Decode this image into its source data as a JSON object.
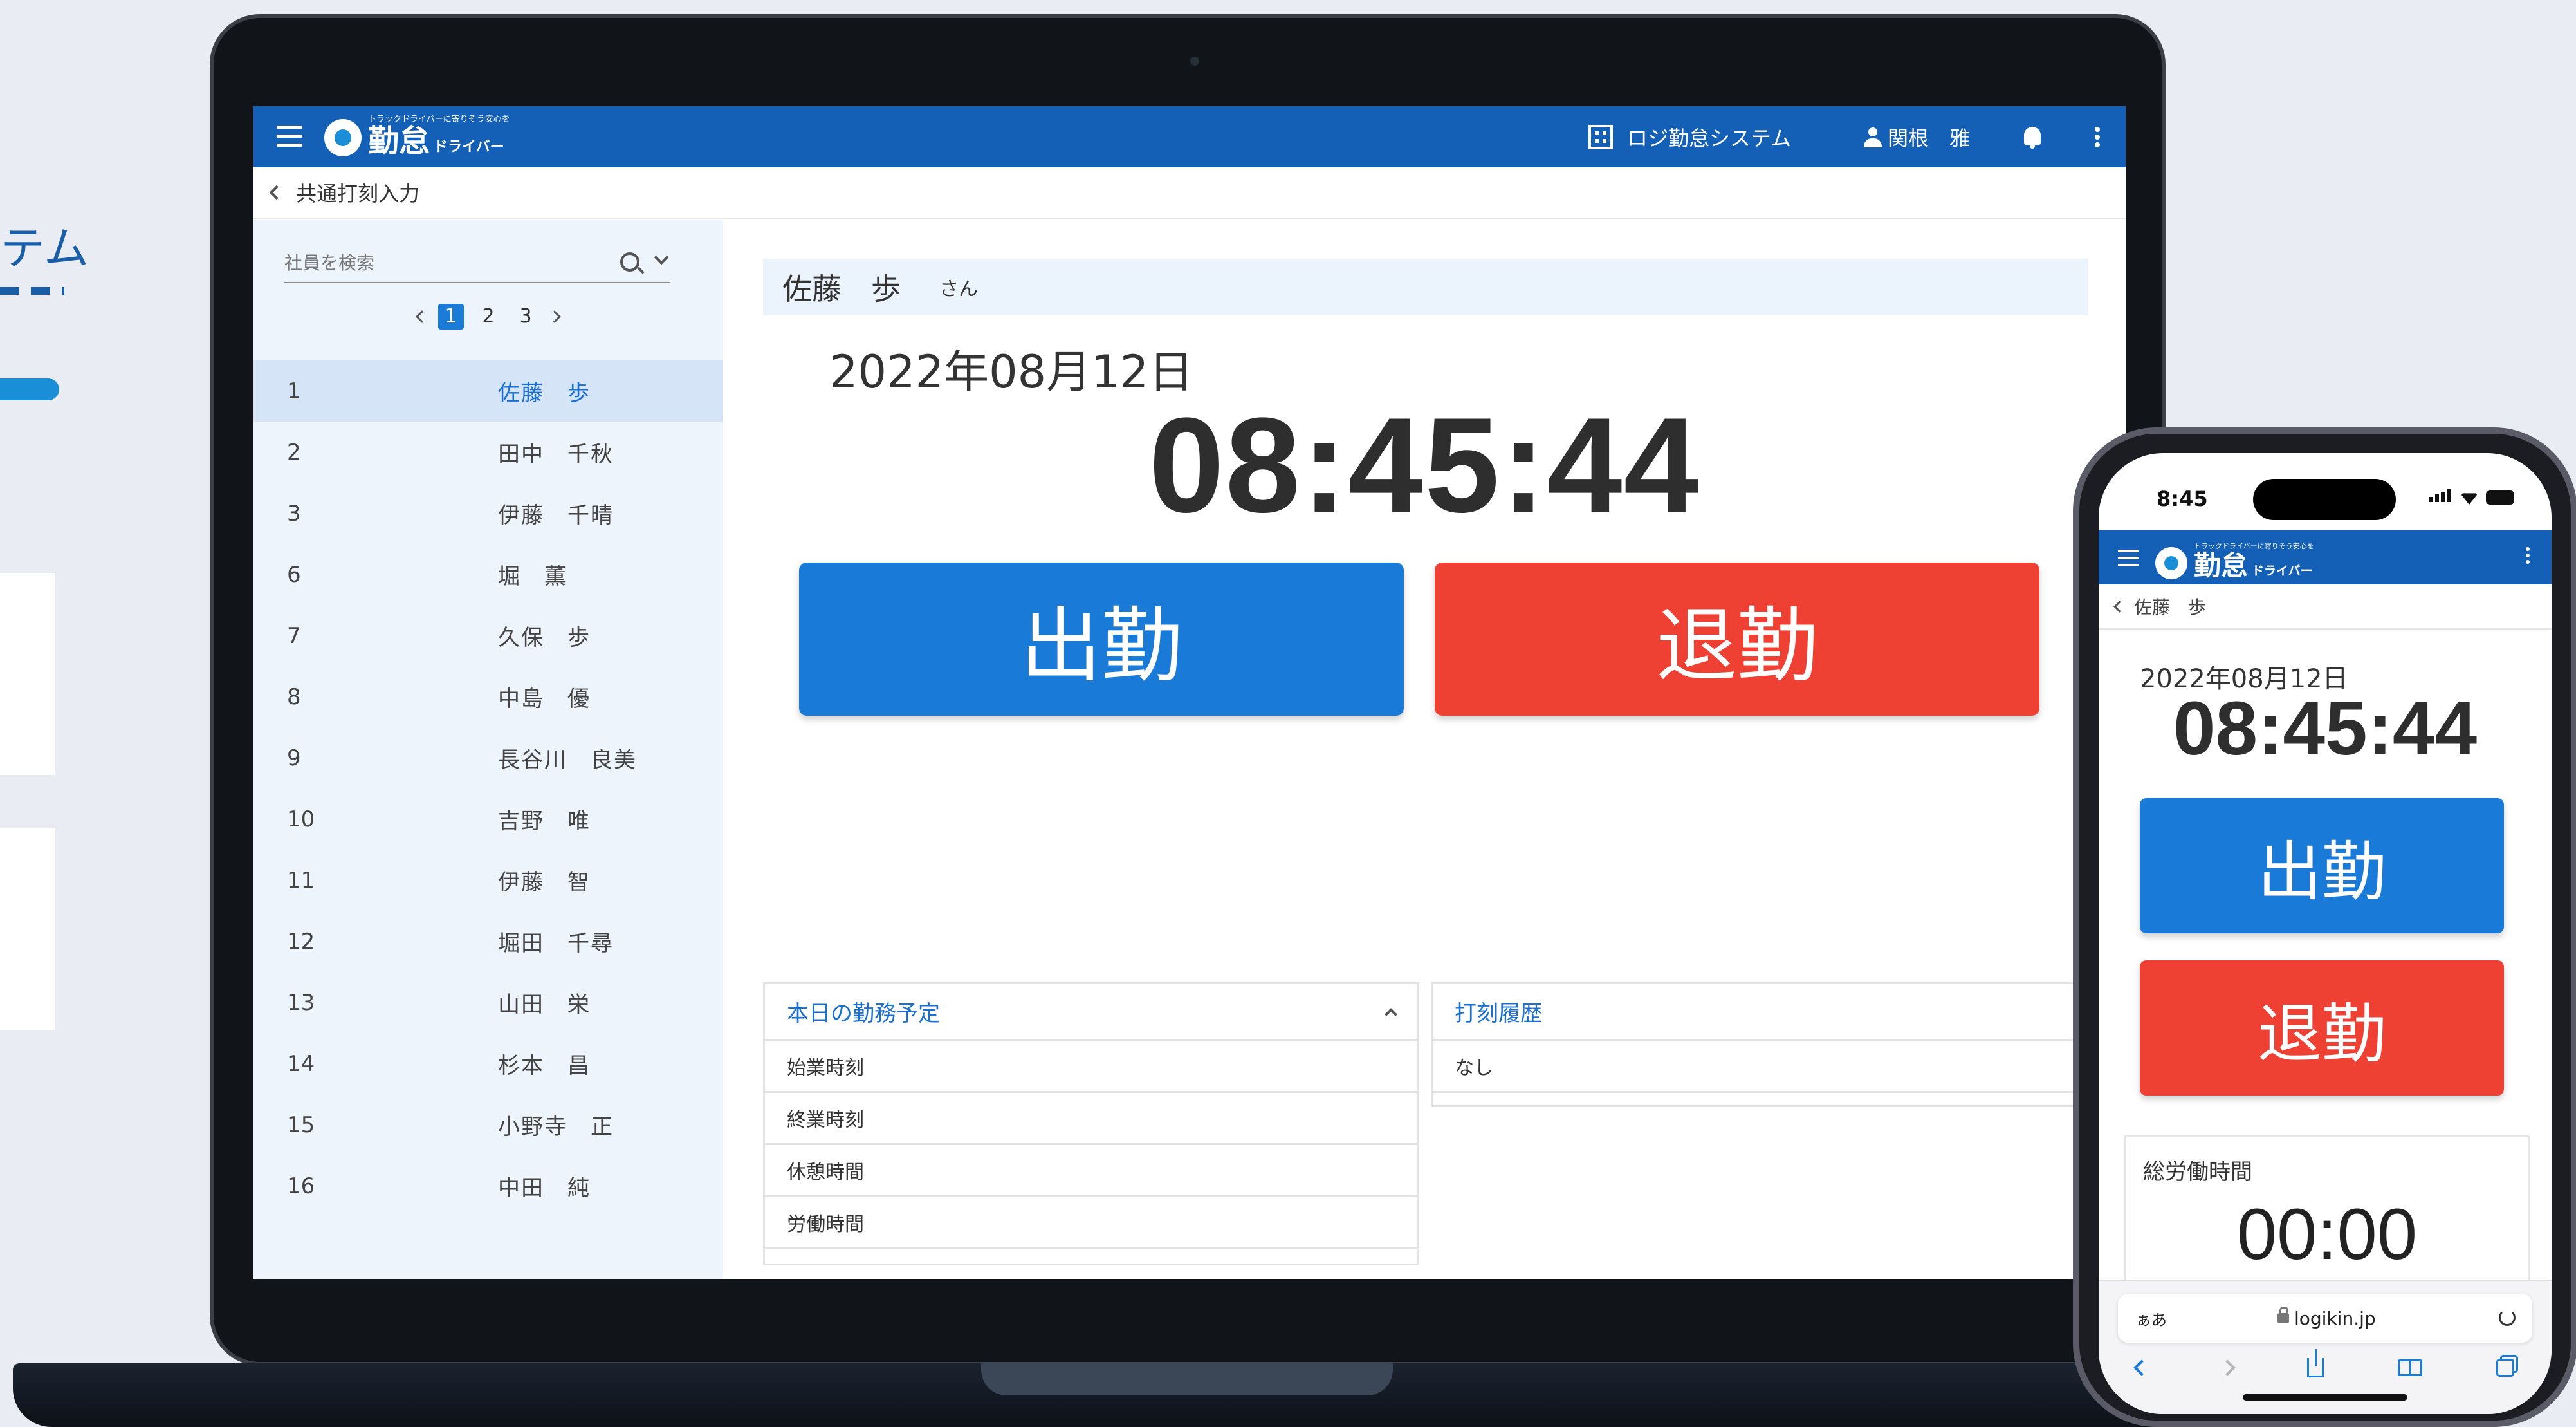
{
  "bg_fragments": {
    "title_fragment": "テム"
  },
  "app": {
    "brand": {
      "tagline": "トラックドライバーに寄りそう安心を",
      "name": "勤怠",
      "sub": "ドライバー"
    },
    "system_name": "ロジ勤怠システム",
    "user_name": "関根　雅",
    "breadcrumb": "共通打刻入力"
  },
  "sidebar": {
    "search_placeholder": "社員を検索",
    "pages": [
      "1",
      "2",
      "3"
    ],
    "active_page": "1",
    "employees": [
      {
        "num": "1",
        "name": "佐藤　歩",
        "selected": true
      },
      {
        "num": "2",
        "name": "田中　千秋"
      },
      {
        "num": "3",
        "name": "伊藤　千晴"
      },
      {
        "num": "6",
        "name": "堀　薫"
      },
      {
        "num": "7",
        "name": "久保　歩"
      },
      {
        "num": "8",
        "name": "中島　優"
      },
      {
        "num": "9",
        "name": "長谷川　良美"
      },
      {
        "num": "10",
        "name": "吉野　唯"
      },
      {
        "num": "11",
        "name": "伊藤　智"
      },
      {
        "num": "12",
        "name": "堀田　千尋"
      },
      {
        "num": "13",
        "name": "山田　栄"
      },
      {
        "num": "14",
        "name": "杉本　昌"
      },
      {
        "num": "15",
        "name": "小野寺　正"
      },
      {
        "num": "16",
        "name": "中田　純"
      }
    ]
  },
  "main": {
    "employee_name": "佐藤　歩",
    "honorific": "さん",
    "date": "2022年08月12日",
    "time": "08:45:44",
    "clock_in_label": "出勤",
    "clock_out_label": "退勤",
    "schedule": {
      "title": "本日の勤務予定",
      "rows": [
        "始業時刻",
        "終業時刻",
        "休憩時間",
        "労働時間"
      ]
    },
    "history": {
      "title": "打刻履歴",
      "rows": [
        "なし"
      ]
    }
  },
  "phone": {
    "status_time": "8:45",
    "breadcrumb": "佐藤　歩",
    "date": "2022年08月12日",
    "time": "08:45:44",
    "clock_in_label": "出勤",
    "clock_out_label": "退勤",
    "total_label": "総労働時間",
    "total_value": "00:00",
    "url_aa": "ぁあ",
    "url": "logikin.jp"
  },
  "colors": {
    "appbar": "#1360b6",
    "clock_in": "#1a7ad7",
    "clock_out": "#ef4034",
    "sidebar_bg": "#eef4fc",
    "selected_row": "#d5e5f7"
  },
  "icons": [
    "hamburger-icon",
    "building-icon",
    "user-icon",
    "bell-icon",
    "kebab-icon",
    "search-icon",
    "chevron-down-icon",
    "chevron-up-icon",
    "chevron-left-icon"
  ]
}
